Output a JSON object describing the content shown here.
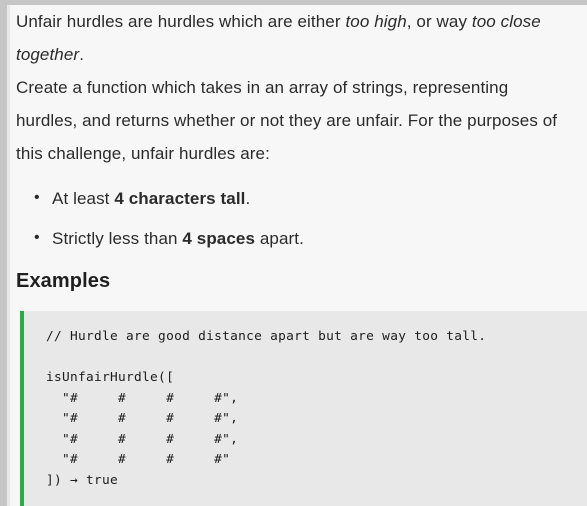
{
  "document": {
    "intro": {
      "prefix": "Unfair hurdles are hurdles which are either ",
      "em1": "too high",
      "mid": ", or way ",
      "em2": "too close together",
      "suffix": "."
    },
    "description": "Create a function which takes in an array of strings, representing hurdles, and returns whether or not they are unfair. For the purposes of this challenge, unfair hurdles are:",
    "rules": [
      {
        "pre": "At least ",
        "strong": "4 characters tall",
        "post": "."
      },
      {
        "pre": "Strictly less than ",
        "strong": "4 spaces",
        "post": " apart."
      }
    ],
    "examples_heading": "Examples",
    "code_block": {
      "comment": "// Hurdle are good distance apart but are way too tall.",
      "code": "// Hurdle are good distance apart but are way too tall.\n\nisUnfairHurdle([\n  \"#     #     #     #\",\n  \"#     #     #     #\",\n  \"#     #     #     #\",\n  \"#     #     #     #\"\n]) → true",
      "accent_color": "#2aab4a",
      "background_color": "#e8e8e8"
    }
  },
  "colors": {
    "page_background": "#f7f7f7",
    "chrome_gray": "#c6c6c6",
    "text": "#2b2b2b",
    "heading": "#1f1f1f"
  }
}
